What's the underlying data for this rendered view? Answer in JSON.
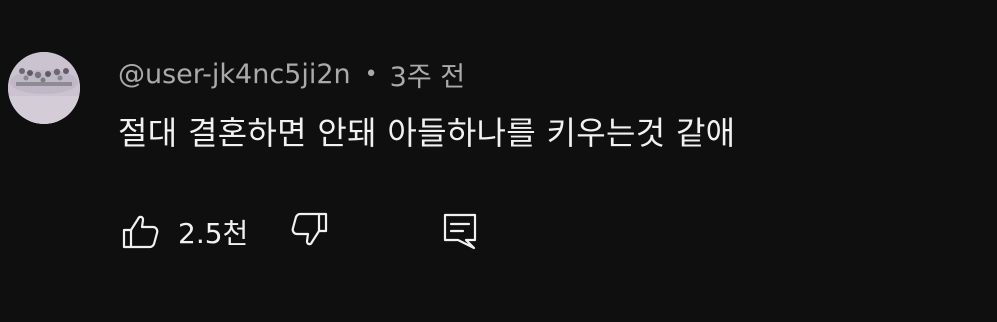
{
  "comment": {
    "author_handle": "@user-jk4nc5ji2n",
    "separator": "•",
    "timestamp": "3주 전",
    "text": "절대 결혼하면 안돼 아들하나를 키우는것 같애",
    "like_count": "2.5천"
  },
  "icons": {
    "like": "thumb-up-icon",
    "dislike": "thumb-down-icon",
    "reply": "reply-comment-icon"
  },
  "colors": {
    "background": "#0f0f0f",
    "primary_text": "#f1f1f1",
    "secondary_text": "#aaaaaa"
  }
}
